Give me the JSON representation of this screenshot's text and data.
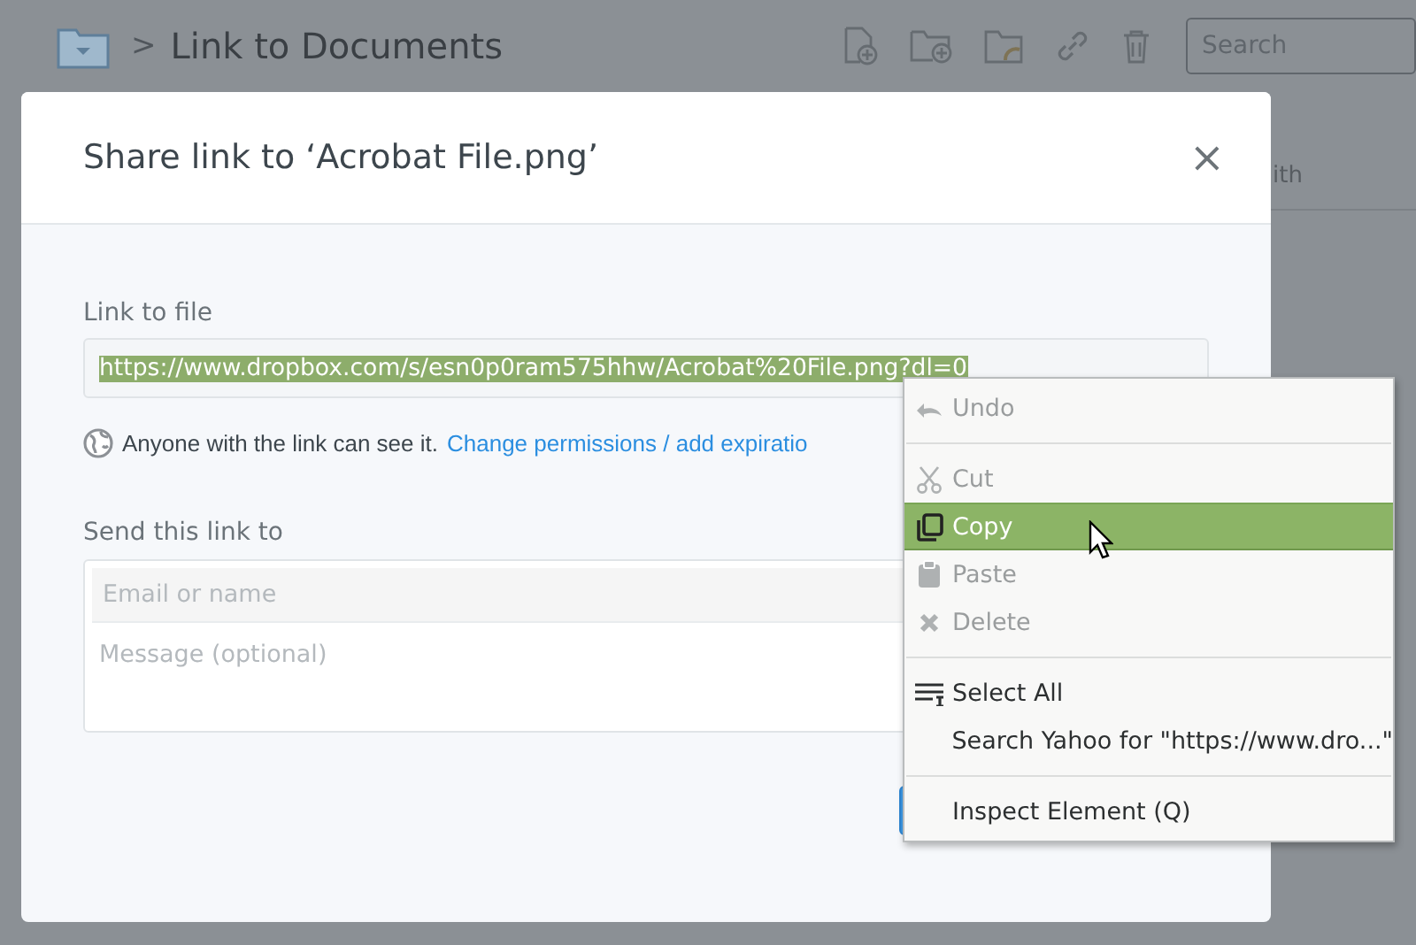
{
  "page": {
    "breadcrumb_separator": ">",
    "title": "Link to Documents",
    "search": {
      "placeholder": "Search"
    },
    "column_header": "ith"
  },
  "dialog": {
    "title": "Share link to ‘Acrobat File.png’",
    "close": "×",
    "link_label": "Link to file",
    "link_value": "https://www.dropbox.com/s/esn0p0ram575hhw/Acrobat%20File.png?dl=0",
    "link_selected": true,
    "visibility_text": "Anyone with the link can see it.",
    "visibility_link": "Change permissions / add expiratio",
    "send_label": "Send this link to",
    "email": {
      "placeholder": "Email or name"
    },
    "message": {
      "placeholder": "Message (optional)"
    }
  },
  "context_menu": {
    "items": [
      {
        "kind": "item",
        "label": "Undo",
        "disabled": true,
        "selected": false
      },
      {
        "kind": "separator"
      },
      {
        "kind": "item",
        "label": "Cut",
        "disabled": true,
        "selected": false
      },
      {
        "kind": "item",
        "label": "Copy",
        "disabled": false,
        "selected": true
      },
      {
        "kind": "item",
        "label": "Paste",
        "disabled": true,
        "selected": false
      },
      {
        "kind": "item",
        "label": "Delete",
        "disabled": true,
        "selected": false
      },
      {
        "kind": "separator"
      },
      {
        "kind": "item",
        "label": "Select All",
        "disabled": false,
        "selected": false
      },
      {
        "kind": "item",
        "label": "Search Yahoo for \"https://www.dro...\"",
        "disabled": false,
        "selected": false
      },
      {
        "kind": "separator"
      },
      {
        "kind": "item",
        "label": "Inspect Element (Q)",
        "disabled": false,
        "selected": false
      }
    ]
  }
}
